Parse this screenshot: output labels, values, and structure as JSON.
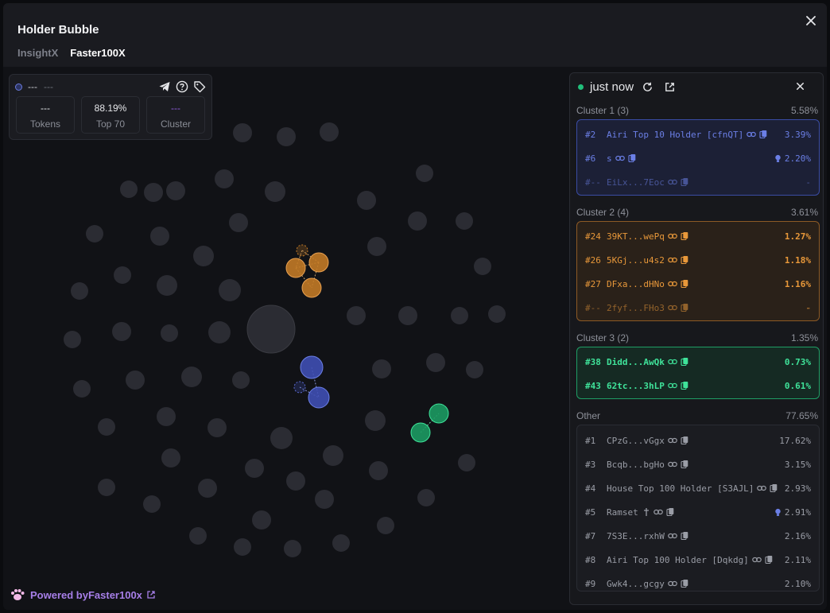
{
  "header": {
    "title": "Holder Bubble",
    "tabs": [
      {
        "label": "InsightX",
        "active": false
      },
      {
        "label": "Faster100X",
        "active": true
      }
    ]
  },
  "stats": {
    "name": "---",
    "address": "---",
    "boxes": [
      {
        "value": "---",
        "label": "Tokens"
      },
      {
        "value": "88.19%",
        "label": "Top 70"
      },
      {
        "value": "---",
        "label": "Cluster"
      }
    ]
  },
  "footer": {
    "powered_prefix": "Powered by ",
    "brand": "Faster100x"
  },
  "panel": {
    "status": "just now",
    "clusters": [
      {
        "title": "Cluster 1 (3)",
        "total": "5.58%",
        "rows": [
          {
            "rank": "#2",
            "name": "Airi Top 10 Holder [cfnQT]",
            "pct": "3.39%"
          },
          {
            "rank": "#6",
            "name": "s",
            "pct": "2.20%",
            "bulb": true
          },
          {
            "rank": "#--",
            "name": "EiLx...7Eoc",
            "pct": "-",
            "faded": true
          }
        ]
      },
      {
        "title": "Cluster 2 (4)",
        "total": "3.61%",
        "rows": [
          {
            "rank": "#24",
            "name": "39KT...wePq",
            "pct": "1.27%"
          },
          {
            "rank": "#26",
            "name": "5KGj...u4s2",
            "pct": "1.18%"
          },
          {
            "rank": "#27",
            "name": "DFxa...dHNo",
            "pct": "1.16%"
          },
          {
            "rank": "#--",
            "name": "2fyf...FHo3",
            "pct": "-",
            "faded": true
          }
        ]
      },
      {
        "title": "Cluster 3 (2)",
        "total": "1.35%",
        "rows": [
          {
            "rank": "#38",
            "name": "Didd...AwQk",
            "pct": "0.73%"
          },
          {
            "rank": "#43",
            "name": "62tc...3hLP",
            "pct": "0.61%"
          }
        ]
      }
    ],
    "other": {
      "title": "Other",
      "total": "77.65%",
      "rows": [
        {
          "rank": "#1",
          "name": "CPzG...vGgx",
          "pct": "17.62%"
        },
        {
          "rank": "#3",
          "name": "Bcqb...bgHo",
          "pct": "3.15%"
        },
        {
          "rank": "#4",
          "name": "House Top 100 Holder [S3AJL]",
          "pct": "2.93%"
        },
        {
          "rank": "#5",
          "name": "Ramset",
          "pct": "2.91%",
          "bulb": true,
          "cross": true
        },
        {
          "rank": "#7",
          "name": "7S3E...rxhW",
          "pct": "2.16%"
        },
        {
          "rank": "#8",
          "name": "Airi Top 100 Holder [Dqkdg]",
          "pct": "2.11%"
        },
        {
          "rank": "#9",
          "name": "Gwk4...gcgy",
          "pct": "2.10%"
        }
      ]
    }
  },
  "colors": {
    "cluster1": "#3f4fb3",
    "cluster2": "#c27a26",
    "cluster3": "#1c9a62",
    "bubble": "#2b2c33"
  }
}
